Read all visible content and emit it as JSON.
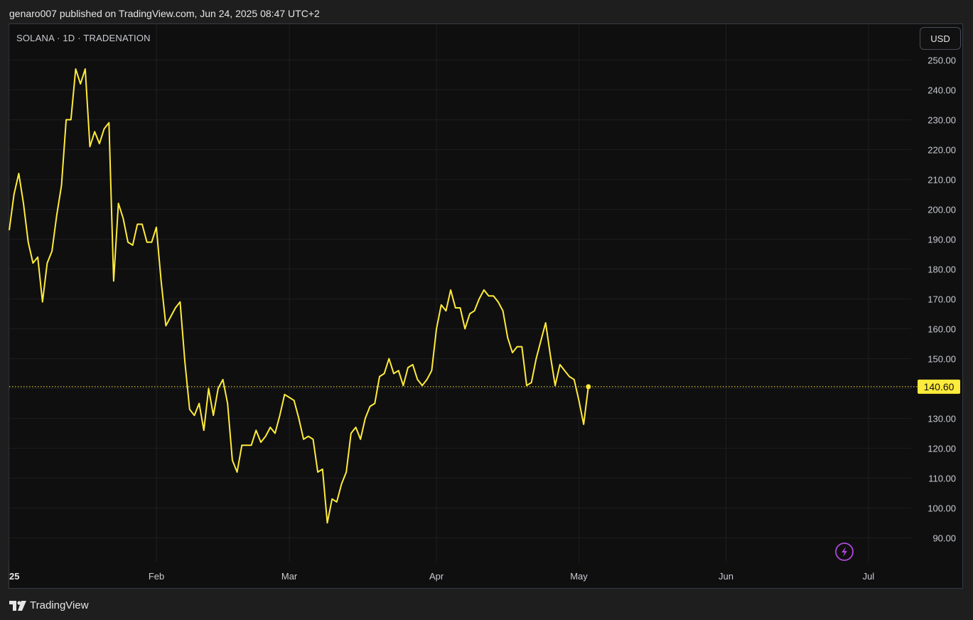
{
  "header": {
    "published_text": "genaro007 published on TradingView.com, Jun 24, 2025 08:47 UTC+2"
  },
  "legend": {
    "symbol_text": "SOLANA · 1D · TRADENATION"
  },
  "toolbar": {
    "currency_label": "USD"
  },
  "footer": {
    "brand_text": "TradingView"
  },
  "icons": {
    "brand_logo": "tradingview-logo-icon",
    "lightning": "lightning-icon"
  },
  "colors": {
    "line": "#ffeb3b",
    "price_label_bg": "#ffeb3b",
    "lightning": "#b048d8",
    "background": "#0f0f0f",
    "grid": "#1f1f22"
  },
  "chart_data": {
    "type": "line",
    "symbol": "SOLANA",
    "interval": "1D",
    "exchange": "TRADENATION",
    "currency": "USD",
    "last_price_label": "140.60",
    "last_price": 140.6,
    "ylim": [
      82,
      262
    ],
    "xlim": [
      "2025-01-01",
      "2025-07-10"
    ],
    "y_ticks": [
      "90.00",
      "100.00",
      "110.00",
      "120.00",
      "130.00",
      "140.00",
      "150.00",
      "160.00",
      "170.00",
      "180.00",
      "190.00",
      "200.00",
      "210.00",
      "220.00",
      "230.00",
      "240.00",
      "250.00"
    ],
    "x_ticks": [
      {
        "date": "2025-01-01",
        "label": "25"
      },
      {
        "date": "2025-02-01",
        "label": "Feb"
      },
      {
        "date": "2025-03-01",
        "label": "Mar"
      },
      {
        "date": "2025-04-01",
        "label": "Apr"
      },
      {
        "date": "2025-05-01",
        "label": "May"
      },
      {
        "date": "2025-06-01",
        "label": "Jun"
      },
      {
        "date": "2025-07-01",
        "label": "Jul"
      }
    ],
    "grid": true,
    "series": [
      {
        "color": "#ffeb3b",
        "points": [
          [
            "2025-01-01",
            193
          ],
          [
            "2025-01-02",
            205
          ],
          [
            "2025-01-03",
            212
          ],
          [
            "2025-01-04",
            202
          ],
          [
            "2025-01-05",
            189
          ],
          [
            "2025-01-06",
            182
          ],
          [
            "2025-01-07",
            184
          ],
          [
            "2025-01-08",
            169
          ],
          [
            "2025-01-09",
            182
          ],
          [
            "2025-01-10",
            186
          ],
          [
            "2025-01-11",
            198
          ],
          [
            "2025-01-12",
            208
          ],
          [
            "2025-01-13",
            230
          ],
          [
            "2025-01-14",
            230
          ],
          [
            "2025-01-15",
            247
          ],
          [
            "2025-01-16",
            242
          ],
          [
            "2025-01-17",
            247
          ],
          [
            "2025-01-18",
            221
          ],
          [
            "2025-01-19",
            226
          ],
          [
            "2025-01-20",
            222
          ],
          [
            "2025-01-21",
            227
          ],
          [
            "2025-01-22",
            229
          ],
          [
            "2025-01-23",
            176
          ],
          [
            "2025-01-24",
            202
          ],
          [
            "2025-01-25",
            197
          ],
          [
            "2025-01-26",
            189
          ],
          [
            "2025-01-27",
            188
          ],
          [
            "2025-01-28",
            195
          ],
          [
            "2025-01-29",
            195
          ],
          [
            "2025-01-30",
            189
          ],
          [
            "2025-01-31",
            189
          ],
          [
            "2025-02-01",
            194
          ],
          [
            "2025-02-02",
            176
          ],
          [
            "2025-02-03",
            161
          ],
          [
            "2025-02-04",
            164
          ],
          [
            "2025-02-05",
            167
          ],
          [
            "2025-02-06",
            169
          ],
          [
            "2025-02-07",
            149
          ],
          [
            "2025-02-08",
            133
          ],
          [
            "2025-02-09",
            131
          ],
          [
            "2025-02-10",
            135
          ],
          [
            "2025-02-11",
            126
          ],
          [
            "2025-02-12",
            140
          ],
          [
            "2025-02-13",
            131
          ],
          [
            "2025-02-14",
            140
          ],
          [
            "2025-02-15",
            143
          ],
          [
            "2025-02-16",
            135
          ],
          [
            "2025-02-17",
            116
          ],
          [
            "2025-02-18",
            112
          ],
          [
            "2025-02-19",
            121
          ],
          [
            "2025-02-20",
            121
          ],
          [
            "2025-02-21",
            121
          ],
          [
            "2025-02-22",
            126
          ],
          [
            "2025-02-23",
            122
          ],
          [
            "2025-02-24",
            124
          ],
          [
            "2025-02-25",
            127
          ],
          [
            "2025-02-26",
            125
          ],
          [
            "2025-02-27",
            131
          ],
          [
            "2025-02-28",
            138
          ],
          [
            "2025-03-01",
            137
          ],
          [
            "2025-03-02",
            136
          ],
          [
            "2025-03-03",
            130
          ],
          [
            "2025-03-04",
            123
          ],
          [
            "2025-03-05",
            124
          ],
          [
            "2025-03-06",
            123
          ],
          [
            "2025-03-07",
            112
          ],
          [
            "2025-03-08",
            113
          ],
          [
            "2025-03-09",
            95
          ],
          [
            "2025-03-10",
            103
          ],
          [
            "2025-03-11",
            102
          ],
          [
            "2025-03-12",
            108
          ],
          [
            "2025-03-13",
            112
          ],
          [
            "2025-03-14",
            125
          ],
          [
            "2025-03-15",
            127
          ],
          [
            "2025-03-16",
            123
          ],
          [
            "2025-03-17",
            130
          ],
          [
            "2025-03-18",
            134
          ],
          [
            "2025-03-19",
            135
          ],
          [
            "2025-03-20",
            144
          ],
          [
            "2025-03-21",
            145
          ],
          [
            "2025-03-22",
            150
          ],
          [
            "2025-03-23",
            145
          ],
          [
            "2025-03-24",
            146
          ],
          [
            "2025-03-25",
            141
          ],
          [
            "2025-03-26",
            147
          ],
          [
            "2025-03-27",
            148
          ],
          [
            "2025-03-28",
            143
          ],
          [
            "2025-03-29",
            141
          ],
          [
            "2025-03-30",
            143
          ],
          [
            "2025-03-31",
            146
          ],
          [
            "2025-04-01",
            160
          ],
          [
            "2025-04-02",
            168
          ],
          [
            "2025-04-03",
            166
          ],
          [
            "2025-04-04",
            173
          ],
          [
            "2025-04-05",
            167
          ],
          [
            "2025-04-06",
            167
          ],
          [
            "2025-04-07",
            160
          ],
          [
            "2025-04-08",
            165
          ],
          [
            "2025-04-09",
            166
          ],
          [
            "2025-04-10",
            170
          ],
          [
            "2025-04-11",
            173
          ],
          [
            "2025-04-12",
            171
          ],
          [
            "2025-04-13",
            171
          ],
          [
            "2025-04-14",
            169
          ],
          [
            "2025-04-15",
            166
          ],
          [
            "2025-04-16",
            157
          ],
          [
            "2025-04-17",
            152
          ],
          [
            "2025-04-18",
            154
          ],
          [
            "2025-04-19",
            154
          ],
          [
            "2025-04-20",
            141
          ],
          [
            "2025-04-21",
            142
          ],
          [
            "2025-04-22",
            150
          ],
          [
            "2025-04-23",
            156
          ],
          [
            "2025-04-24",
            162
          ],
          [
            "2025-04-25",
            151
          ],
          [
            "2025-04-26",
            141
          ],
          [
            "2025-04-27",
            148
          ],
          [
            "2025-04-28",
            146
          ],
          [
            "2025-04-29",
            144
          ],
          [
            "2025-04-30",
            143
          ],
          [
            "2025-05-01",
            136
          ],
          [
            "2025-05-02",
            128
          ],
          [
            "2025-05-03",
            140.6
          ]
        ]
      }
    ]
  }
}
